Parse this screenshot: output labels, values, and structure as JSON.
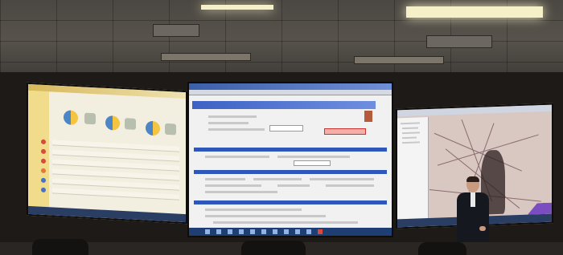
{
  "scene": {
    "description_colors": {
      "ceiling": "#55514a",
      "wall": "#1d1a17",
      "screen_blue": "#2d57b8",
      "pie_yellow": "#f4c542",
      "pie_blue": "#4c86c6",
      "map_bg": "#d9c7c2"
    }
  }
}
